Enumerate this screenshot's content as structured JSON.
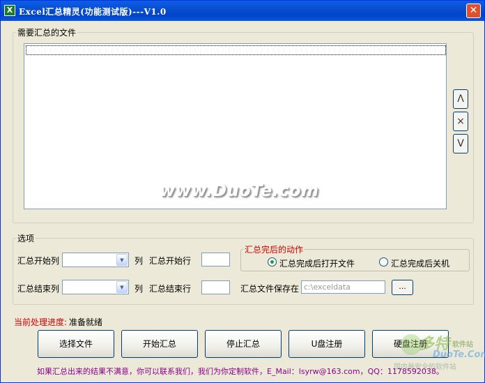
{
  "window": {
    "title": "Excel汇总精灵(功能测试版)---V1.0",
    "icon": "excel-icon",
    "close_glyph": "✕"
  },
  "files_group": {
    "legend": "需要汇总的文件",
    "watermark": "www.DuoTe.com",
    "buttons": {
      "up": "Λ",
      "remove": "×",
      "down": "V"
    }
  },
  "options_group": {
    "legend": "选项",
    "start_col_label": "汇总开始列",
    "end_col_label": "汇总结束列",
    "col_suffix": "列",
    "start_row_label": "汇总开始行",
    "end_row_label": "汇总结束行",
    "start_col_value": "",
    "end_col_value": "",
    "start_row_value": "",
    "end_row_value": "",
    "after_action": {
      "legend": "汇总完后的动作",
      "option_open": "汇总完成后打开文件",
      "option_shutdown": "汇总完成后关机",
      "selected": "option_open"
    },
    "save_path_label": "汇总文件保存在",
    "save_path_value": "c:\\exceldata",
    "browse_label": "..."
  },
  "status": {
    "label": "当前处理进度:",
    "value": "准备就绪"
  },
  "actions": {
    "select_files": "选择文件",
    "start": "开始汇总",
    "stop": "停止汇总",
    "usb_register": "U盘注册",
    "disk_register": "硬盘注册"
  },
  "footer": {
    "text": "如果汇总出来的结果不满意，你可以联系我们，我们为你定制软件，E_Mail：lsyrw@163.com，QQ：1178592038。"
  },
  "logo_watermark": {
    "main": "多特",
    "sub_top": "软件站",
    "domain": "DuoTe.Com",
    "slogan": "国内最安全的软件站"
  },
  "colors": {
    "title_bar": "#0a4fd0",
    "dialog_bg": "#ece9d8",
    "accent_red": "#d00000",
    "footer": "#8b008b",
    "radio_dot": "#21a121"
  }
}
